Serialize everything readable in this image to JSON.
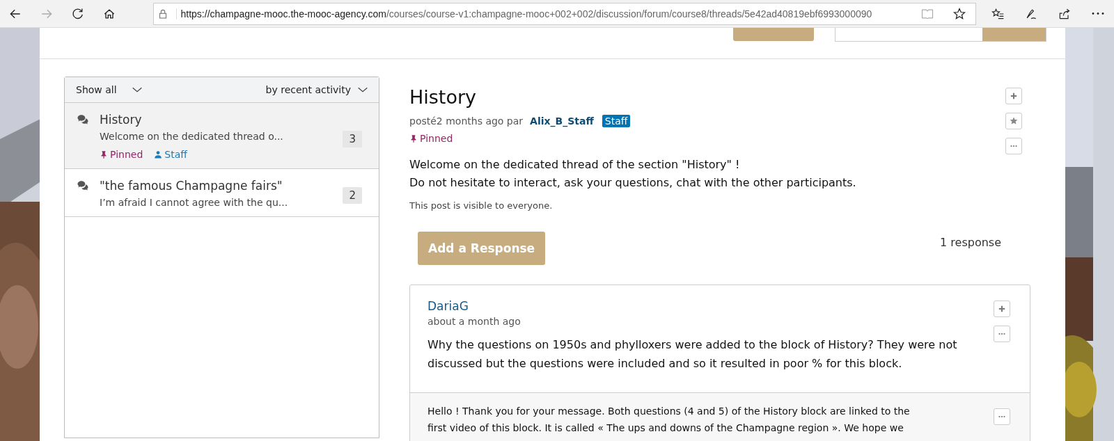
{
  "browser": {
    "url_host": "https://champagne-mooc.the-mooc-agency.com",
    "url_path": "/courses/course-v1:champagne-mooc+002+002/discussion/forum/course8/threads/5e42ad40819ebf6993000090"
  },
  "thread_list": {
    "filter": "Show all",
    "sort": "by recent activity",
    "threads": [
      {
        "title": "History",
        "preview": "Welcome on the dedicated thread o...",
        "count": "3",
        "selected": true,
        "tags": [
          {
            "kind": "pinned",
            "label": "Pinned"
          },
          {
            "kind": "staff",
            "label": "Staff"
          }
        ]
      },
      {
        "title": "\"the famous Champagne fairs\"",
        "preview": "I’m afraid I cannot agree with the qu...",
        "count": "2",
        "selected": false
      }
    ]
  },
  "thread": {
    "title": "History",
    "meta_prefix": "posté2 months ago par",
    "author": "Alix_B_Staff",
    "author_badge": "Staff",
    "pinned_label": "Pinned",
    "body": [
      "Welcome on the dedicated thread of the section \"History\" !",
      "Do not hesitate to interact, ask your questions, chat with the other participants."
    ],
    "visibility": "This post is visible to everyone.",
    "add_response": "Add a Response",
    "response_count": "1 response"
  },
  "responses": [
    {
      "author": "DariaG",
      "time": "about a month ago",
      "body": "Why the questions on 1950s and phylloxers were added to the block of History? They were not discussed but the questions were included and so it resulted in poor % for this block.",
      "comments": [
        {
          "lines": [
            "Hello ! Thank you for your message. Both questions (4 and 5) of the History block are linked to the",
            "first video of this block. It is called « The ups and downs of the Champagne region ». We hope we"
          ]
        }
      ]
    }
  ]
}
